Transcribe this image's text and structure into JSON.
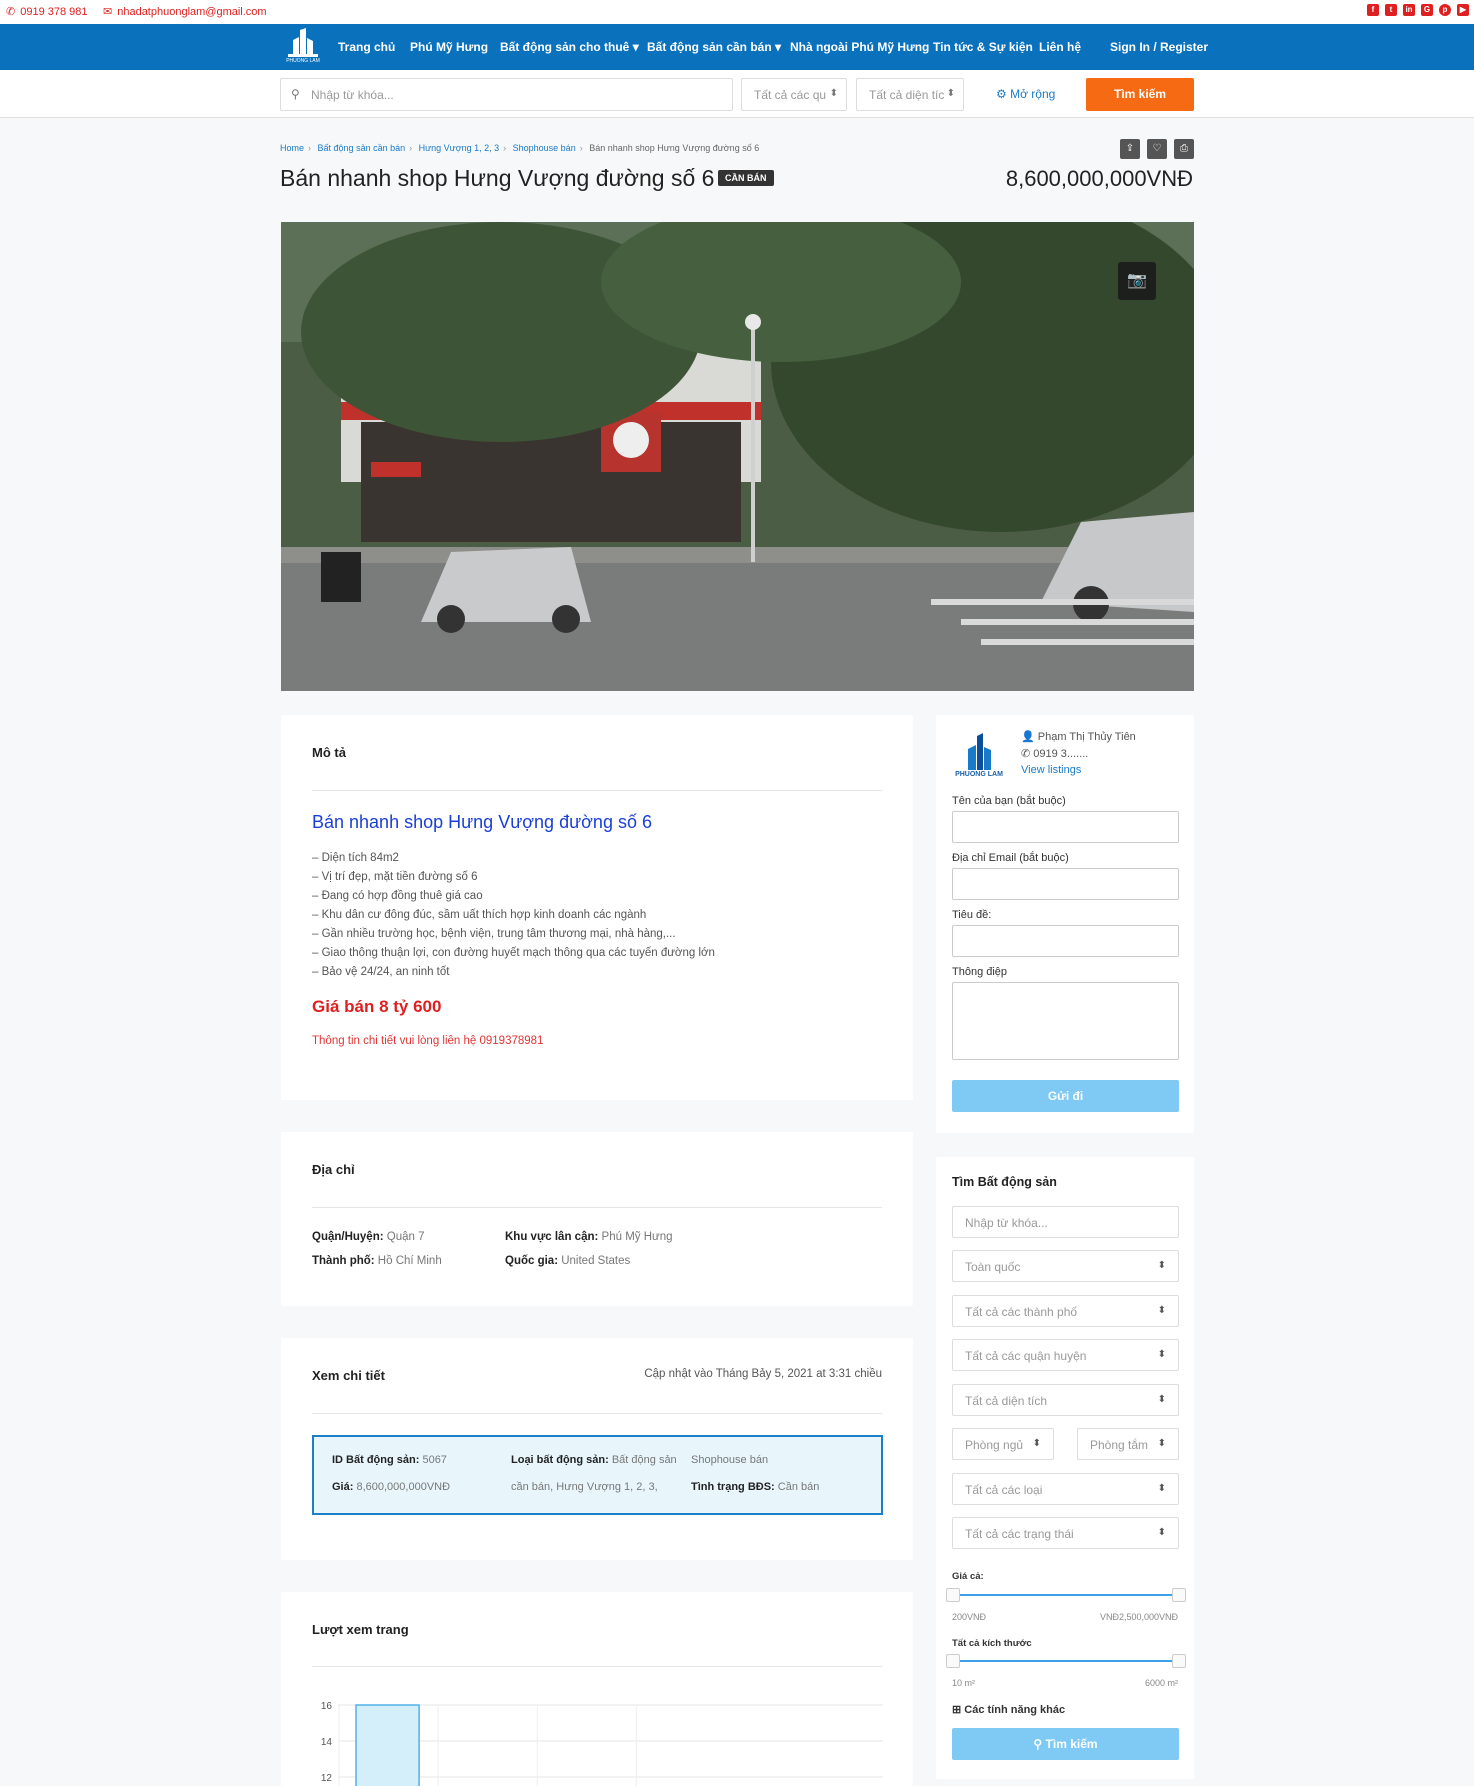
{
  "topbar": {
    "phone": "0919 378 981",
    "email": "nhadatphuonglam@gmail.com",
    "social": [
      "facebook-icon",
      "twitter-icon",
      "linkedin-icon",
      "google-plus-icon",
      "pinterest-icon",
      "youtube-icon"
    ]
  },
  "brand": {
    "logo_text": "PHUONG LAM"
  },
  "nav": {
    "items": [
      {
        "label": "Trang chủ"
      },
      {
        "label": "Phú Mỹ Hưng"
      },
      {
        "label": "Bất động sản cho thuê"
      },
      {
        "label": "Bất động sản cần bán"
      },
      {
        "label": "Nhà ngoài Phú Mỹ Hưng"
      },
      {
        "label": "Tin tức & Sự kiện"
      },
      {
        "label": "Liên hệ"
      }
    ],
    "signin": "Sign In / Register"
  },
  "search": {
    "placeholder": "Nhập từ khóa...",
    "district": "Tất cả các qu",
    "area": "Tất cả diện tíc",
    "more": "Mở rộng",
    "button": "Tìm kiếm"
  },
  "breadcrumb": {
    "home": "Home",
    "c1": "Bất động sản cần bán",
    "c2": "Hưng Vượng 1, 2, 3",
    "c3": "Shophouse bán",
    "current": "Bán nhanh shop Hưng Vượng đường số 6"
  },
  "listing": {
    "title": "Bán nhanh shop Hưng Vượng đường số 6",
    "tag": "CẦN BÁN",
    "price": "8,600,000,000VNĐ"
  },
  "description": {
    "heading": "Mô tả",
    "title": "Bán nhanh shop Hưng Vượng đường số 6",
    "features": [
      "– Diện tích 84m2",
      "– Vị trí đẹp, mặt tiền đường số 6",
      "– Đang có hợp đồng thuê giá cao",
      "– Khu dân cư đông đúc, sầm uất thích hợp kinh doanh các ngành",
      "– Gần nhiều trường học, bệnh viện, trung tâm thương mại, nhà hàng,...",
      "– Giao thông thuận lợi, con đường huyết mạch thông qua các tuyến đường lớn",
      "– Bảo vệ 24/24, an ninh tốt"
    ],
    "sale_price": "Giá bán 8 tỷ 600",
    "contact": "Thông tin chi tiết vui lòng liên hệ 0919378981"
  },
  "address": {
    "heading": "Địa chỉ",
    "district_label": "Quận/Huyện:",
    "district": "Quận 7",
    "city_label": "Thành phố:",
    "city": "Hồ Chí Minh",
    "area_label": "Khu vực lân cận:",
    "area": "Phú Mỹ Hưng",
    "country_label": "Quốc gia:",
    "country": "United States"
  },
  "details": {
    "heading": "Xem chi tiết",
    "updated": "Cập nhật vào Tháng Bảy 5, 2021 at 3:31 chiều",
    "id_label": "ID Bất động sản:",
    "id": "5067",
    "price_label": "Giá:",
    "price": "8,600,000,000VNĐ",
    "type_label": "Loại bất động sản:",
    "type_value1": "Bất động sản",
    "type_value2": "cần bán, Hưng Vượng 1, 2, 3,",
    "type_value3": "Shophouse bán",
    "status_label": "Tình trạng BĐS:",
    "status": "Cần bán"
  },
  "views": {
    "heading": "Lượt xem trang"
  },
  "chart_data": {
    "type": "bar",
    "title": "",
    "ylim": [
      11,
      16
    ],
    "yticks": [
      16,
      14,
      12
    ],
    "categories": [
      "",
      "",
      ""
    ],
    "values": [
      16,
      0,
      0
    ],
    "bar_color": "#d4eefa",
    "bar_border": "#4fb3e8"
  },
  "agent": {
    "logo_text": "PHUONG LAM",
    "name": "Phạm Thị Thủy Tiên",
    "phone": "0919 3.......",
    "listings": "View listings",
    "name_label": "Tên của bạn (bắt buộc)",
    "email_label": "Địa chỉ Email (bắt buộc)",
    "subject_label": "Tiêu đề:",
    "message_label": "Thông điệp",
    "send": "Gửi đi"
  },
  "widget": {
    "heading": "Tìm Bất động sản",
    "keyword_placeholder": "Nhập từ khóa...",
    "country": "Toàn quốc",
    "city": "Tất cả các thành phố",
    "district": "Tất cả các quận huyện",
    "area": "Tất cả diện tích",
    "bedrooms": "Phòng ngủ",
    "bathrooms": "Phòng tắm",
    "type": "Tất cả các loại",
    "status": "Tất cả các trạng thái",
    "price_label": "Giá cả:",
    "price_min": "200VNĐ",
    "price_max": "VNĐ2,500,000VNĐ",
    "size_label": "Tất cả kích thước",
    "size_min": "10 m²",
    "size_max": "6000 m²",
    "more_features": "Các tính năng khác",
    "button": "Tìm kiếm"
  },
  "colors": {
    "primary": "#0a71bd",
    "accent": "#f56a12",
    "red": "#e02020",
    "light_blue": "#7fcaf4"
  }
}
